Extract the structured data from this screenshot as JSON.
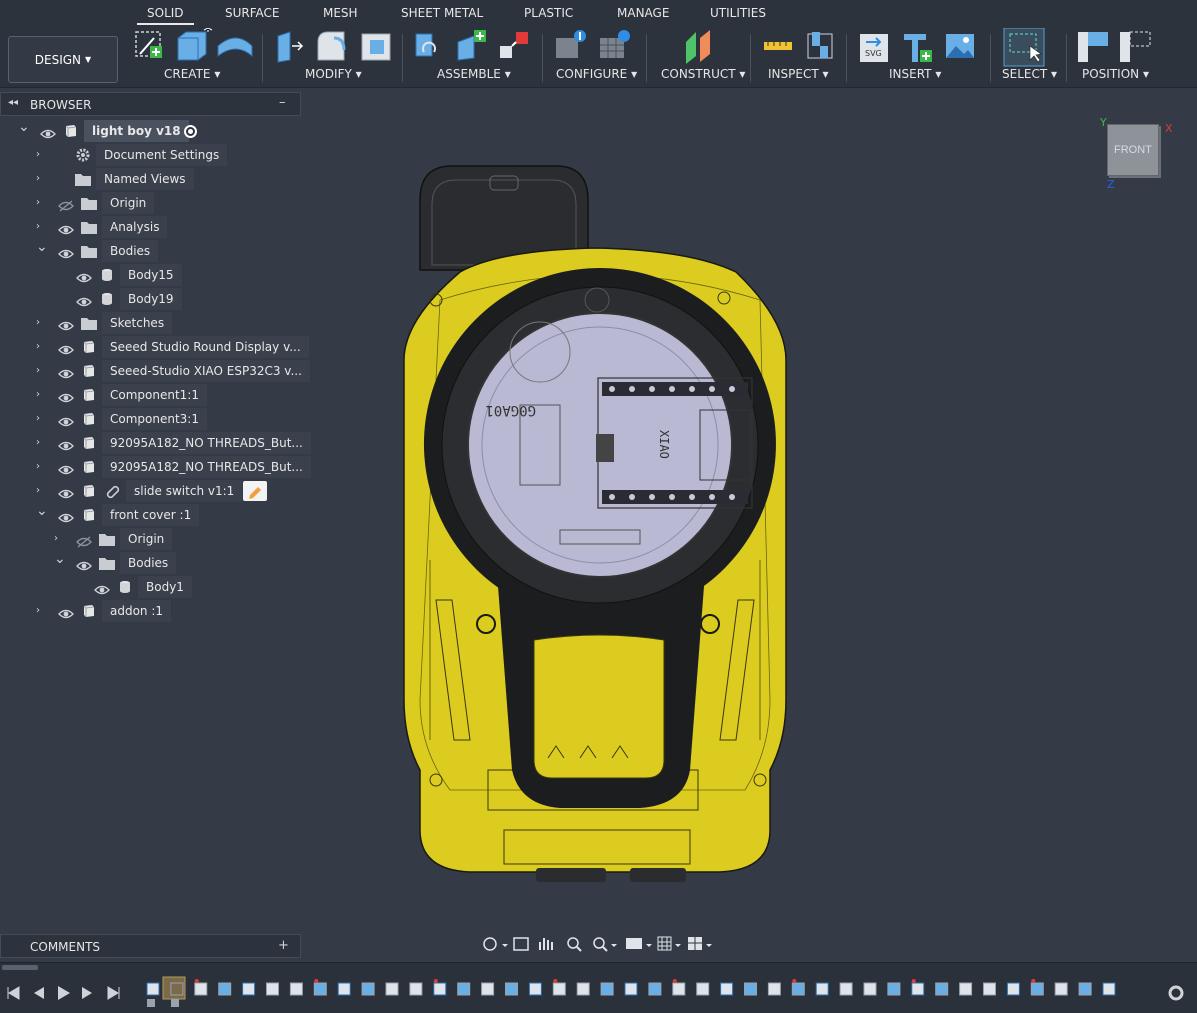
{
  "tabs": [
    "SOLID",
    "SURFACE",
    "MESH",
    "SHEET METAL",
    "PLASTIC",
    "MANAGE",
    "UTILITIES"
  ],
  "active_tab": "SOLID",
  "workspace": "DESIGN",
  "tool_groups": [
    "CREATE",
    "MODIFY",
    "ASSEMBLE",
    "CONFIGURE",
    "CONSTRUCT",
    "INSPECT",
    "INSERT",
    "SELECT",
    "POSITION"
  ],
  "browser": {
    "title": "BROWSER",
    "collapse": "–",
    "items": [
      {
        "label": "light boy v18",
        "depth": 0,
        "expanded": true,
        "icon": "component-icon"
      },
      {
        "label": "Document Settings",
        "depth": 1,
        "expanded": false,
        "icon": "gear-icon"
      },
      {
        "label": "Named Views",
        "depth": 1,
        "expanded": false,
        "icon": "folder-icon"
      },
      {
        "label": "Origin",
        "depth": 1,
        "expanded": false,
        "icon": "folder-icon"
      },
      {
        "label": "Analysis",
        "depth": 1,
        "expanded": false,
        "icon": "folder-icon"
      },
      {
        "label": "Bodies",
        "depth": 1,
        "expanded": true,
        "icon": "folder-icon"
      },
      {
        "label": "Body15",
        "depth": 2,
        "expanded": null,
        "icon": "body-icon"
      },
      {
        "label": "Body19",
        "depth": 2,
        "expanded": null,
        "icon": "body-icon"
      },
      {
        "label": "Sketches",
        "depth": 1,
        "expanded": false,
        "icon": "folder-icon"
      },
      {
        "label": "Seeed Studio Round Display v...",
        "depth": 1,
        "expanded": false,
        "icon": "component-icon"
      },
      {
        "label": "Seeed-Studio XIAO ESP32C3 v...",
        "depth": 1,
        "expanded": false,
        "icon": "component-icon"
      },
      {
        "label": "Component1:1",
        "depth": 1,
        "expanded": false,
        "icon": "component-icon"
      },
      {
        "label": "Component3:1",
        "depth": 1,
        "expanded": false,
        "icon": "component-icon"
      },
      {
        "label": "92095A182_NO THREADS_But...",
        "depth": 1,
        "expanded": false,
        "icon": "component-icon"
      },
      {
        "label": "92095A182_NO THREADS_But...",
        "depth": 1,
        "expanded": false,
        "icon": "component-icon"
      },
      {
        "label": "slide switch v1:1",
        "depth": 1,
        "expanded": false,
        "icon": "component-icon"
      },
      {
        "label": "front cover :1",
        "depth": 1,
        "expanded": true,
        "icon": "component-icon"
      },
      {
        "label": "Origin",
        "depth": 2,
        "expanded": false,
        "icon": "folder-icon"
      },
      {
        "label": "Bodies",
        "depth": 2,
        "expanded": true,
        "icon": "folder-icon"
      },
      {
        "label": "Body1",
        "depth": 3,
        "expanded": null,
        "icon": "body-icon"
      },
      {
        "label": "addon :1",
        "depth": 1,
        "expanded": false,
        "icon": "component-icon"
      }
    ]
  },
  "comments": {
    "title": "COMMENTS",
    "add": "+"
  },
  "viewcube": {
    "face": "FRONT",
    "axis_x": "X",
    "axis_y": "Y",
    "axis_z": "Z"
  },
  "model_text": {
    "chip": "G0GA01",
    "board": "XIAO"
  },
  "colors": {
    "accent": "#e5d21a",
    "background": "#343b47",
    "panel": "#2d333d"
  }
}
